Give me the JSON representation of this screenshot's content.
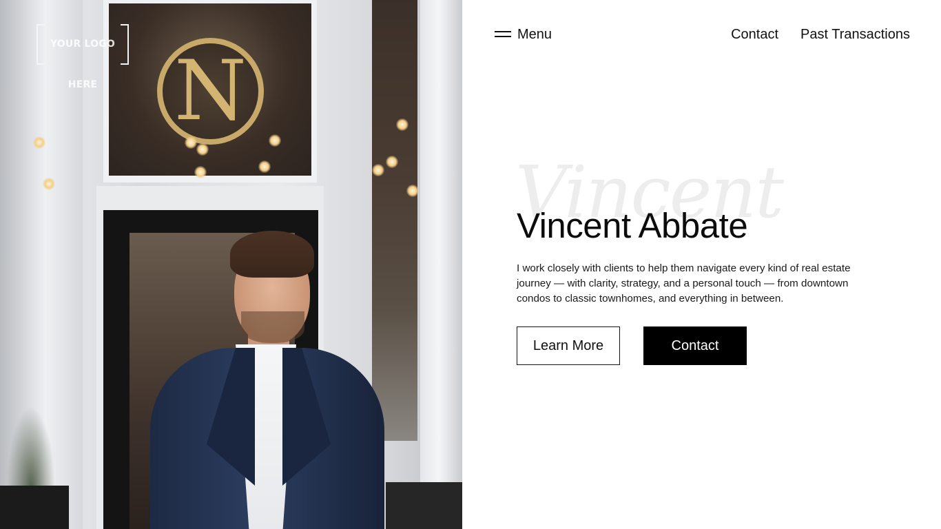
{
  "logo": {
    "text": "YOUR LOGO HERE"
  },
  "nav": {
    "menu_label": "Menu",
    "links": [
      "Contact",
      "Past Transactions"
    ]
  },
  "hero": {
    "script_word": "Vincent",
    "name": "Vincent Abbate",
    "description": "I work closely with clients to help them navigate every kind of real estate journey — with clarity, strategy, and a personal touch — from downtown condos to classic townhomes, and everything in between.",
    "primary_button": "Learn More",
    "secondary_button": "Contact"
  },
  "colors": {
    "background": "#ffffff",
    "text": "#111111",
    "button_dark": "#000000",
    "script_watermark": "#ededed"
  },
  "icons": [
    "hamburger-menu-icon"
  ]
}
